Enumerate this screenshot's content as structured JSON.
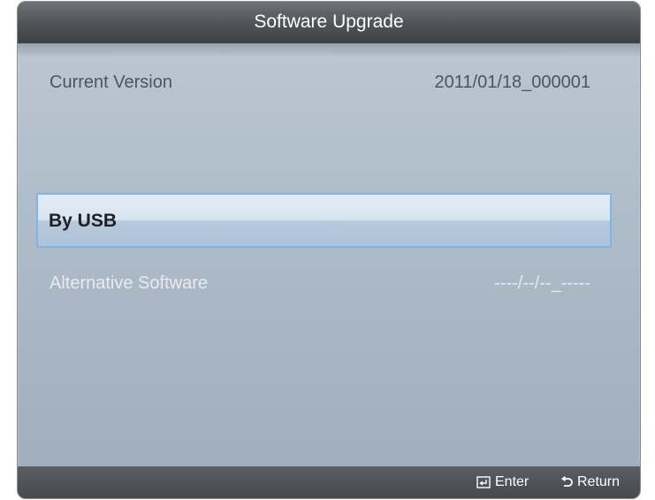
{
  "dialog": {
    "title": "Software Upgrade"
  },
  "current_version": {
    "label": "Current Version",
    "value": "2011/01/18_000001"
  },
  "menu": {
    "selected_item": "By USB"
  },
  "alternative_software": {
    "label": "Alternative Software",
    "value": "----/--/--_-----"
  },
  "footer": {
    "enter_icon": "enter-icon",
    "enter_label": "Enter",
    "return_icon": "return-icon",
    "return_label": "Return"
  },
  "colors": {
    "highlight_border": "#7fb6e3",
    "title_bar": "#4f5256",
    "panel": "#aebcc9"
  }
}
